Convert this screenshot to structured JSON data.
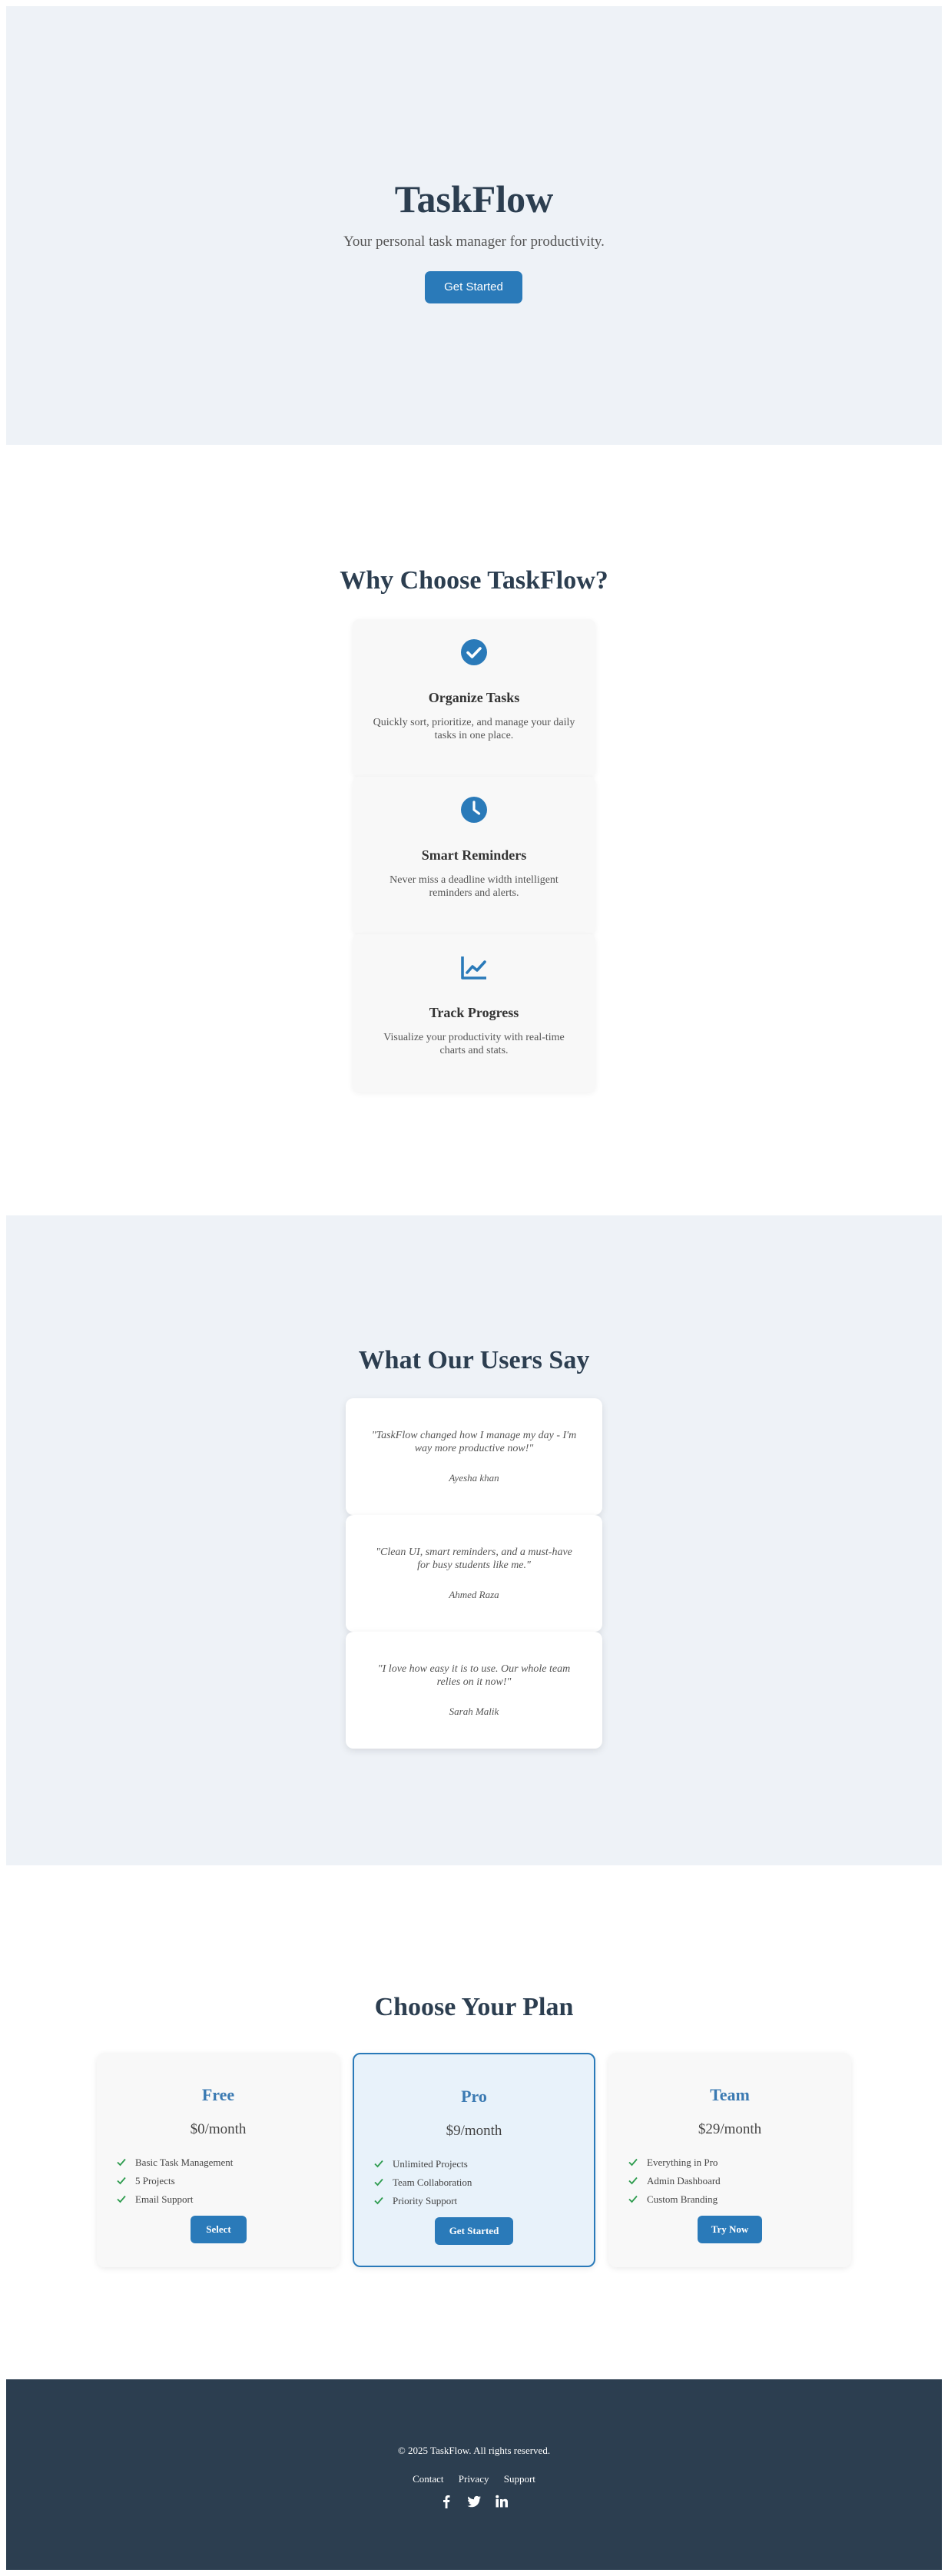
{
  "hero": {
    "title": "TaskFlow",
    "subtitle": "Your personal task manager for productivity.",
    "cta_label": "Get Started"
  },
  "features": {
    "title": "Why Choose TaskFlow?",
    "items": [
      {
        "icon": "check-circle-icon",
        "title": "Organize Tasks",
        "desc": "Quickly sort, prioritize, and manage your daily tasks in one place."
      },
      {
        "icon": "clock-icon",
        "title": "Smart Reminders",
        "desc": "Never miss a deadline width intelligent reminders and alerts."
      },
      {
        "icon": "chart-line-icon",
        "title": "Track Progress",
        "desc": "Visualize your productivity with real-time charts and stats."
      }
    ]
  },
  "testimonials": {
    "title": "What Our Users Say",
    "items": [
      {
        "quote": "\"TaskFlow changed how I manage my day - I'm way more productive now!\"",
        "author": "Ayesha khan"
      },
      {
        "quote": "\"Clean UI, smart reminders, and a must-have for busy students like me.\"",
        "author": "Ahmed Raza"
      },
      {
        "quote": "\"I love how easy it is to use. Our whole team relies on it now!\"",
        "author": "Sarah Malik"
      }
    ]
  },
  "pricing": {
    "title": "Choose Your Plan",
    "plans": [
      {
        "name": "Free",
        "price": "$0/month",
        "features": [
          "Basic Task Management",
          "5 Projects",
          "Email Support"
        ],
        "button": "Select"
      },
      {
        "name": "Pro",
        "price": "$9/month",
        "features": [
          "Unlimited Projects",
          "Team Collaboration",
          "Priority Support"
        ],
        "button": "Get Started"
      },
      {
        "name": "Team",
        "price": "$29/month",
        "features": [
          "Everything in Pro",
          "Admin Dashboard",
          "Custom Branding"
        ],
        "button": "Try Now"
      }
    ]
  },
  "footer": {
    "copyright": "© 2025 TaskFlow. All rights reserved.",
    "links": [
      "Contact",
      "Privacy",
      "Support"
    ],
    "socials": [
      "facebook-icon",
      "twitter-icon",
      "linkedin-icon"
    ]
  },
  "colors": {
    "accent": "#2a7ab9",
    "hero_bg": "#eef2f7",
    "footer_bg": "#2c3e50",
    "check": "#2e9c4f"
  }
}
